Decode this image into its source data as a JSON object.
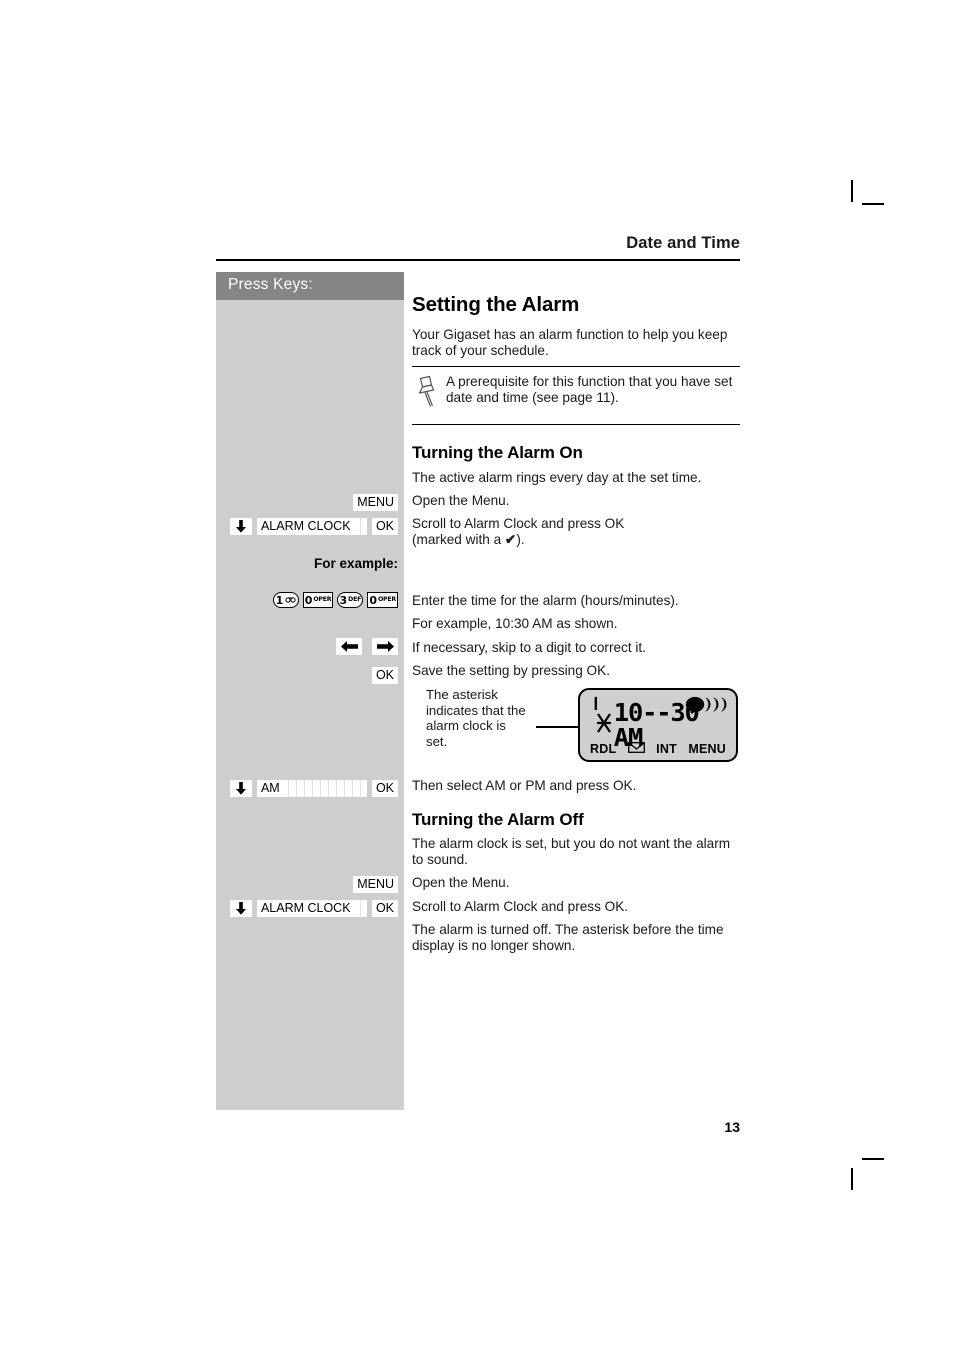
{
  "page": {
    "running_head": "Date and Time",
    "folio": "13",
    "colors": {
      "sidebar_bg": "#cecece",
      "sidebar_header_bg": "#858585",
      "lcd_bg": "#cfcfcf",
      "text": "#1a1a1a"
    }
  },
  "sidebar": {
    "header_label": "Press Keys:",
    "for_example_label": "For example:",
    "rows": {
      "menu_on": {
        "menu_label": "MENU"
      },
      "alarm_on": {
        "field_label": "ALARM CLOCK",
        "ok_label": "OK",
        "scroll_icon": "down-arrow-icon"
      },
      "ampm": {
        "field_label": "AM",
        "ok_label": "OK",
        "scroll_icon": "down-arrow-icon"
      },
      "menu_off": {
        "menu_label": "MENU"
      },
      "alarm_off": {
        "field_label": "ALARM CLOCK",
        "ok_label": "OK",
        "scroll_icon": "down-arrow-icon"
      },
      "save_ok": {
        "ok_label": "OK"
      }
    },
    "keypad": [
      {
        "digit": "1",
        "sub": "",
        "icon": "voicemail-icon",
        "rounded": true
      },
      {
        "digit": "0",
        "sub": "OPER",
        "icon": "",
        "rounded": false
      },
      {
        "digit": "3",
        "sub": "DEF",
        "icon": "",
        "rounded": true
      },
      {
        "digit": "0",
        "sub": "OPER",
        "icon": "",
        "rounded": false
      }
    ],
    "navkeys": [
      {
        "icon": "left-arrow-icon"
      },
      {
        "icon": "right-arrow-icon"
      }
    ]
  },
  "content": {
    "section_title": "Setting the Alarm",
    "intro": "Your Gigaset has an alarm function to help you keep track of your schedule.",
    "note": {
      "icon": "pushpin-icon",
      "text": "A prerequisite for this function that you have set date and time (see page 11)."
    },
    "alarm_on": {
      "heading": "Turning the Alarm On",
      "line_intro": "The active alarm rings every day at the set time.",
      "line_menu": "Open the Menu.",
      "line_scroll_1": "Scroll to Alarm Clock and press OK",
      "line_scroll_2_pre": "(marked with a ",
      "line_scroll_2_mark": "✔",
      "line_scroll_2_post": ").",
      "line_enter": "Enter the time for the alarm (hours/minutes).",
      "line_example": "For example, 10:30 AM as shown.",
      "line_skip": "If necessary, skip to a digit to correct it.",
      "line_save": "Save the setting by pressing OK.",
      "line_ampm": "Then select AM or PM and press OK."
    },
    "lcd": {
      "caption": "The asterisk indicates that the alarm clock is set.",
      "cursor": "❙",
      "asterisk": "✳",
      "time": "10--30 AM",
      "battery_icon": "signal-strength-icon",
      "softkey_left": "RDL",
      "softkey_envelope": "envelope-icon",
      "softkey_int": "INT",
      "softkey_menu": "MENU"
    },
    "alarm_off": {
      "heading": "Turning the Alarm Off",
      "line_intro": "The alarm clock is set, but you do not want the alarm to sound.",
      "line_menu": "Open the Menu.",
      "line_scroll": "Scroll to Alarm Clock and press OK.",
      "line_result": "The alarm is turned off. The asterisk before the time display is no longer shown."
    }
  }
}
